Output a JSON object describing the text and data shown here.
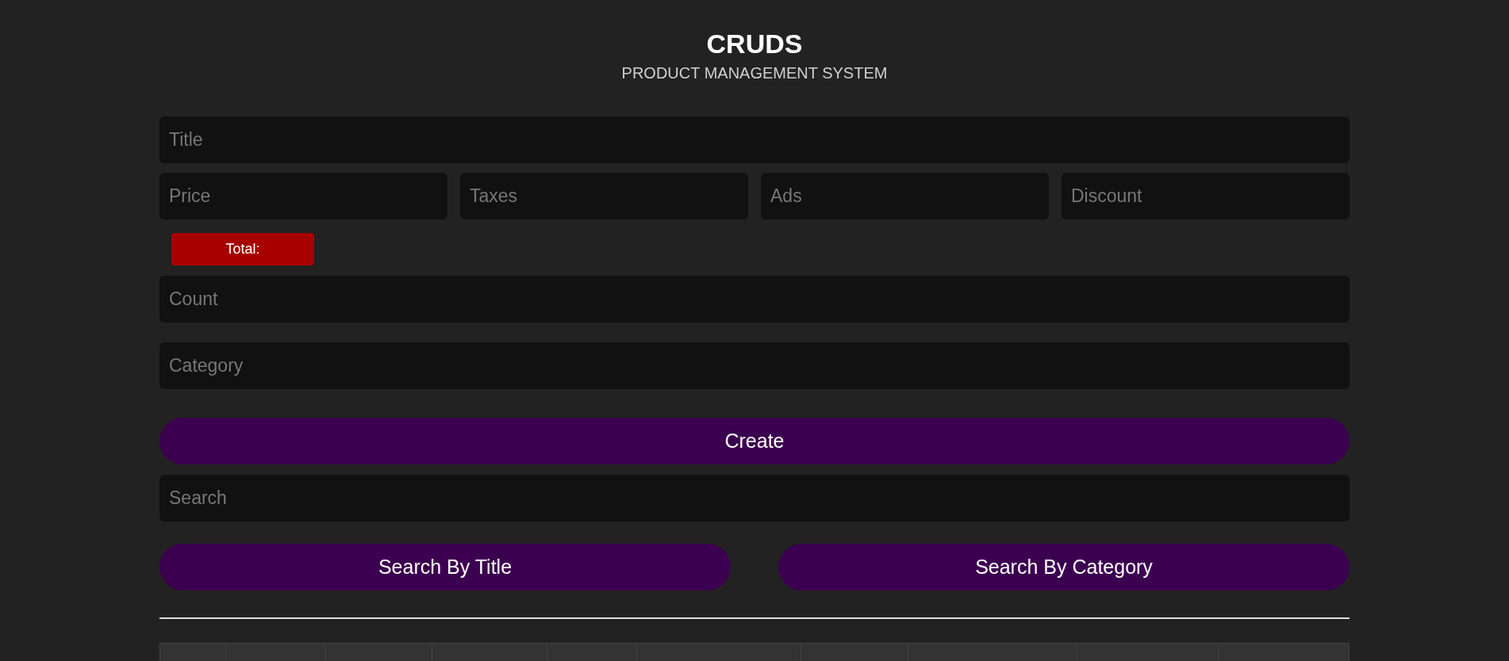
{
  "header": {
    "title": "CRUDS",
    "subtitle": "PRODUCT MANAGEMENT SYSTEM"
  },
  "form": {
    "title_field": {
      "placeholder": "Title"
    },
    "price_fields": [
      {
        "placeholder": "Price"
      },
      {
        "placeholder": "Taxes"
      },
      {
        "placeholder": "Ads"
      },
      {
        "placeholder": "Discount"
      }
    ],
    "total": {
      "label": "Total:"
    },
    "count_field": {
      "placeholder": "Count"
    },
    "category_field": {
      "placeholder": "Category"
    },
    "create_button": "Create"
  },
  "search": {
    "field": {
      "placeholder": "Search"
    },
    "buttons": [
      "Search By Title",
      "Search By Category"
    ]
  },
  "table": {
    "columns": [
      {
        "kind": "header"
      },
      {
        "kind": "header"
      },
      {
        "kind": "header"
      },
      {
        "kind": "header"
      },
      {
        "kind": "header"
      },
      {
        "kind": "header"
      },
      {
        "kind": "header"
      },
      {
        "kind": "header"
      },
      {
        "kind": "header"
      },
      {
        "kind": "header"
      }
    ]
  }
}
